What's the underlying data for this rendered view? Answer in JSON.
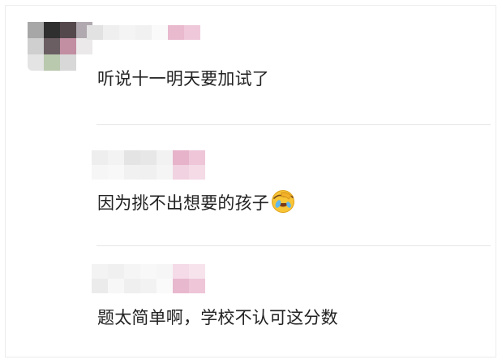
{
  "comments": [
    {
      "text": "听说十一明天要加试了"
    },
    {
      "text": "因为挑不出想要的孩子",
      "emoji": "face-palm-crying-laughing-emoji"
    },
    {
      "text": "题太简单啊，学校不认可这分数"
    }
  ],
  "colors": {
    "text": "#222222",
    "divider": "#e6e6e6",
    "mosaic_pink": "#e8b8cf",
    "mosaic_gray": "#dddddd"
  }
}
